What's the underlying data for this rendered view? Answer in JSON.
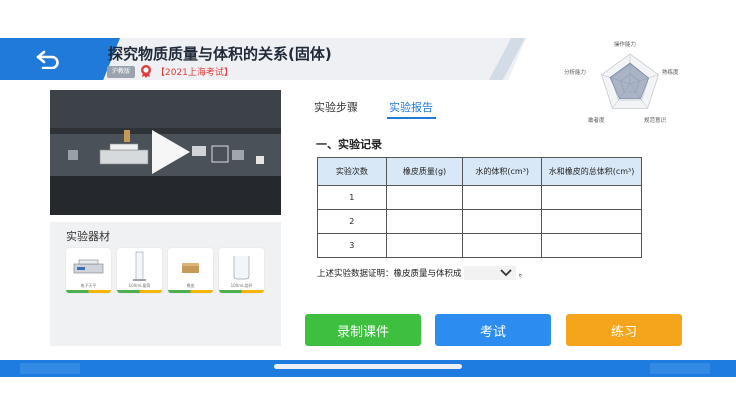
{
  "header": {
    "title": "探究物质质量与体积的关系(固体)",
    "publisher": "沪教版",
    "exam_tag": "【2021上海考试】",
    "back_icon": "back-arrow-icon"
  },
  "radar": {
    "labels": [
      "操作能力",
      "熟练度",
      "规范意识",
      "敢者度",
      "分析能力"
    ],
    "values": [
      0.7,
      0.65,
      0.6,
      0.6,
      0.7
    ],
    "accent": "#6f7fa0"
  },
  "video": {
    "play_icon": "play-icon"
  },
  "equipment": {
    "title": "实验器材",
    "items": [
      {
        "name": "电子天平",
        "icon": "scale-icon"
      },
      {
        "name": "100mL量筒",
        "icon": "graduated-cylinder-icon"
      },
      {
        "name": "橡皮",
        "icon": "eraser-icon"
      },
      {
        "name": "100mL烧杯",
        "icon": "beaker-icon"
      }
    ]
  },
  "tabs": {
    "steps": "实验步骤",
    "report": "实验报告",
    "active": "report"
  },
  "section": {
    "title": "一、实验记录"
  },
  "table": {
    "headers": [
      "实验次数",
      "橡皮质量(g)",
      "水的体积(cm³)",
      "水和橡皮的总体积(cm³)"
    ],
    "rows": [
      [
        "1",
        "",
        "",
        ""
      ],
      [
        "2",
        "",
        "",
        ""
      ],
      [
        "3",
        "",
        "",
        ""
      ]
    ]
  },
  "conclusion": {
    "prefix": "上述实验数据证明：橡皮质量与体积成",
    "suffix": "。",
    "selected": ""
  },
  "buttons": {
    "record": "录制课件",
    "exam": "考试",
    "practice": "练习"
  },
  "colors": {
    "primary": "#1f7ad9",
    "green": "#3fbf3f",
    "blue": "#2d8cf0",
    "orange": "#f5a51b",
    "danger": "#e03b3b"
  }
}
